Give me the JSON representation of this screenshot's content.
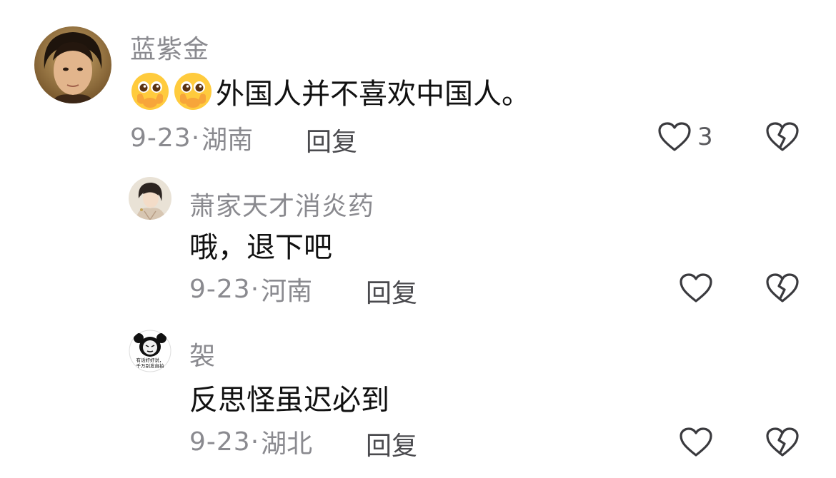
{
  "comments": [
    {
      "username": "蓝紫金",
      "emoji": "pleading-face-hands-over-mouth-emoji",
      "text": "外国人并不喜欢中国人。",
      "date": "9-23·",
      "location": "湖南",
      "reply_label": "回复",
      "like_count": "3"
    },
    {
      "username": "萧家天才消炎药",
      "text": "哦，退下吧",
      "date": "9-23·",
      "location": "河南",
      "reply_label": "回复",
      "like_count": ""
    },
    {
      "username": "袈",
      "avatar_caption": [
        "有话好好说，",
        "千万别发自拍"
      ],
      "text": "反思怪虽迟必到",
      "date": "9-23·",
      "location": "湖北",
      "reply_label": "回复",
      "like_count": ""
    }
  ],
  "icons": {
    "like": "heart-outline-icon",
    "dislike": "broken-heart-icon"
  },
  "colors": {
    "meta_text": "#8a8a8f",
    "body_text": "#111111",
    "icon_stroke": "#3a3a3e"
  }
}
